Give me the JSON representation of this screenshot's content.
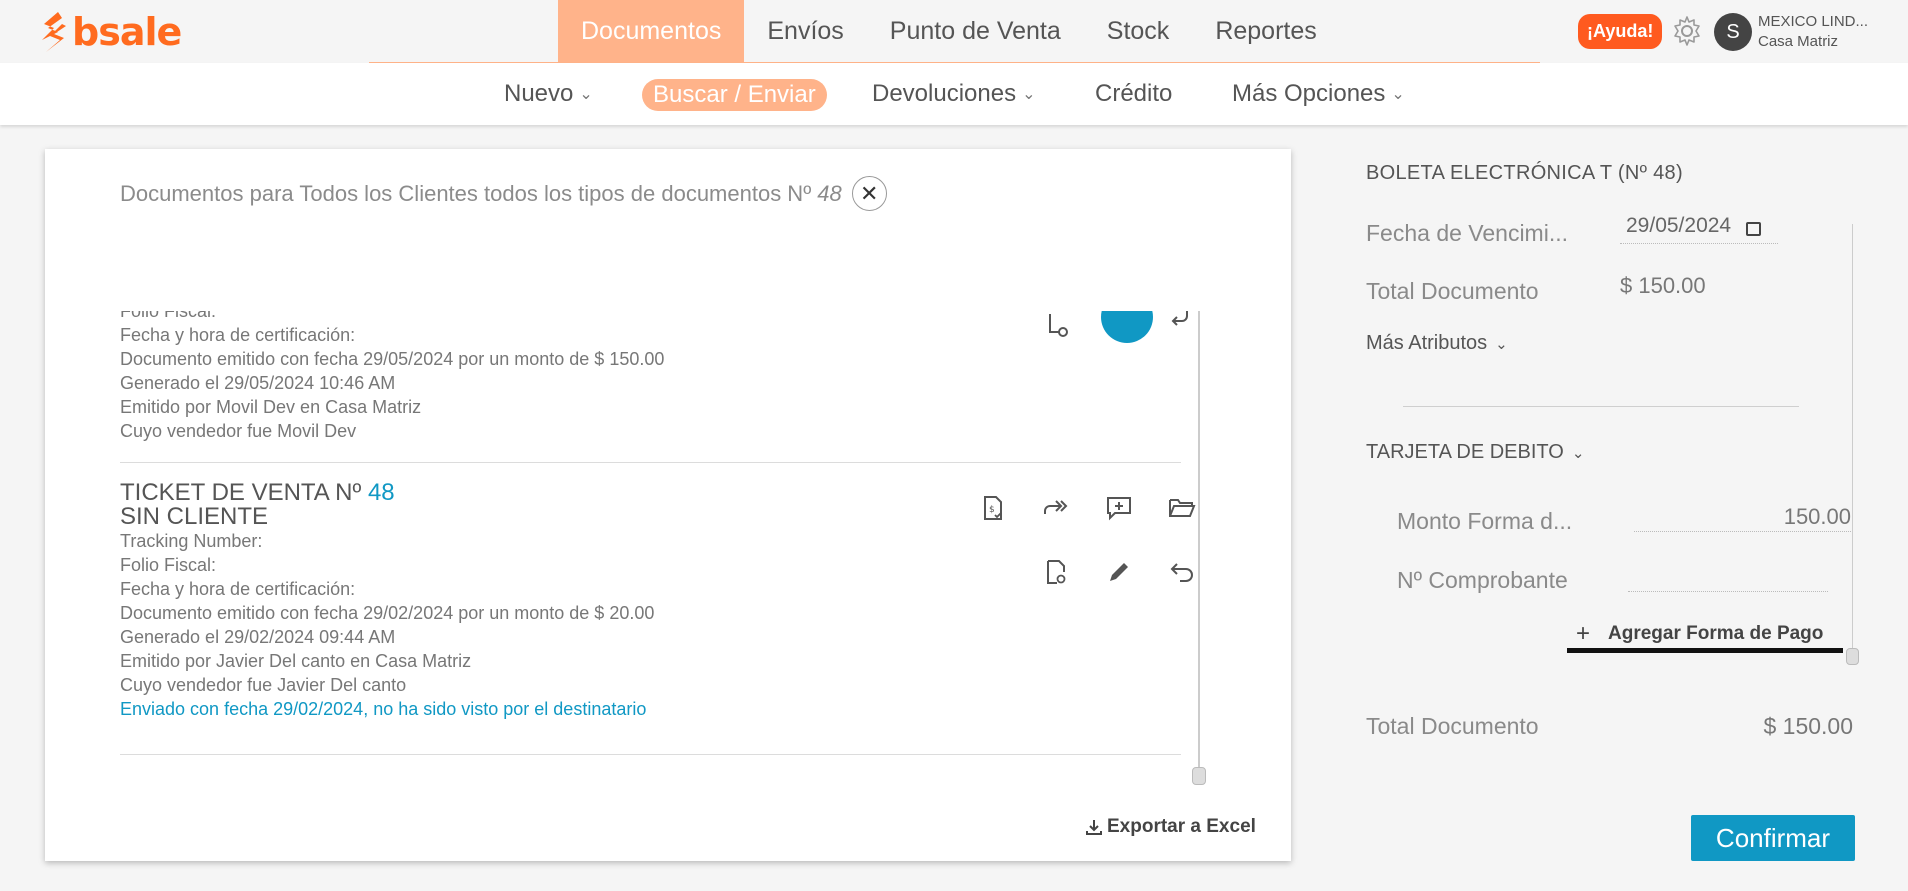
{
  "brand": {
    "name": "bsale",
    "color": "#ff6b1f"
  },
  "main_nav": {
    "items": [
      {
        "label": "Documentos",
        "active": true
      },
      {
        "label": "Envíos",
        "active": false
      },
      {
        "label": "Punto de Venta",
        "active": false
      },
      {
        "label": "Stock",
        "active": false
      },
      {
        "label": "Reportes",
        "active": false
      }
    ]
  },
  "header": {
    "help_label": "¡Ayuda!",
    "avatar_initial": "S",
    "account_name": "MEXICO LIND...",
    "account_branch": "Casa Matriz"
  },
  "sub_nav": {
    "nuevo": "Nuevo",
    "buscar": "Buscar / Enviar",
    "devoluciones": "Devoluciones",
    "credito": "Crédito",
    "mas_opciones": "Más Opciones"
  },
  "search_panel": {
    "title": "Documentos para Todos los Clientes todos los tipos de documentos Nº",
    "number": "48",
    "export_label": "Exportar a Excel"
  },
  "entries": [
    {
      "lines": [
        "Folio Fiscal:",
        "Fecha y hora de certificación:",
        "Documento emitido con fecha 29/05/2024 por un monto de $ 150.00",
        "Generado el 29/05/2024 10:46 AM",
        "Emitido por Movil Dev en Casa Matriz",
        "Cuyo vendedor fue Movil Dev"
      ]
    },
    {
      "heading_prefix": "TICKET DE VENTA Nº",
      "heading_number": "48",
      "client": "SIN CLIENTE",
      "lines": [
        "Tracking Number:",
        "Folio Fiscal:",
        "Fecha y hora de certificación:",
        "Documento emitido con fecha 29/02/2024 por un monto de $ 20.00",
        "Generado el 29/02/2024 09:44 AM",
        "Emitido por Javier Del canto en Casa Matriz",
        "Cuyo vendedor fue Javier Del canto"
      ],
      "sent_status": "Enviado con fecha 29/02/2024, no ha sido visto por el destinatario"
    }
  ],
  "right_panel": {
    "doc_title": "BOLETA ELECTRÓNICA T (Nº 48)",
    "due_date_label": "Fecha de Vencimi...",
    "due_date_value": "29/05/2024",
    "total_label": "Total Documento",
    "total_value": "$ 150.00",
    "more_attrs": "Más Atributos",
    "payment_method": "TARJETA DE DEBITO",
    "amount_label": "Monto Forma d...",
    "amount_value": "150.00",
    "voucher_label": "Nº Comprobante",
    "add_payment": "Agregar Forma de Pago",
    "footer_total_label": "Total Documento",
    "footer_total_value": "$ 150.00",
    "confirm_label": "Confirmar"
  },
  "colors": {
    "accent_orange": "#ffb38a",
    "help_orange": "#ff5a1f",
    "link_blue": "#1098c4"
  }
}
